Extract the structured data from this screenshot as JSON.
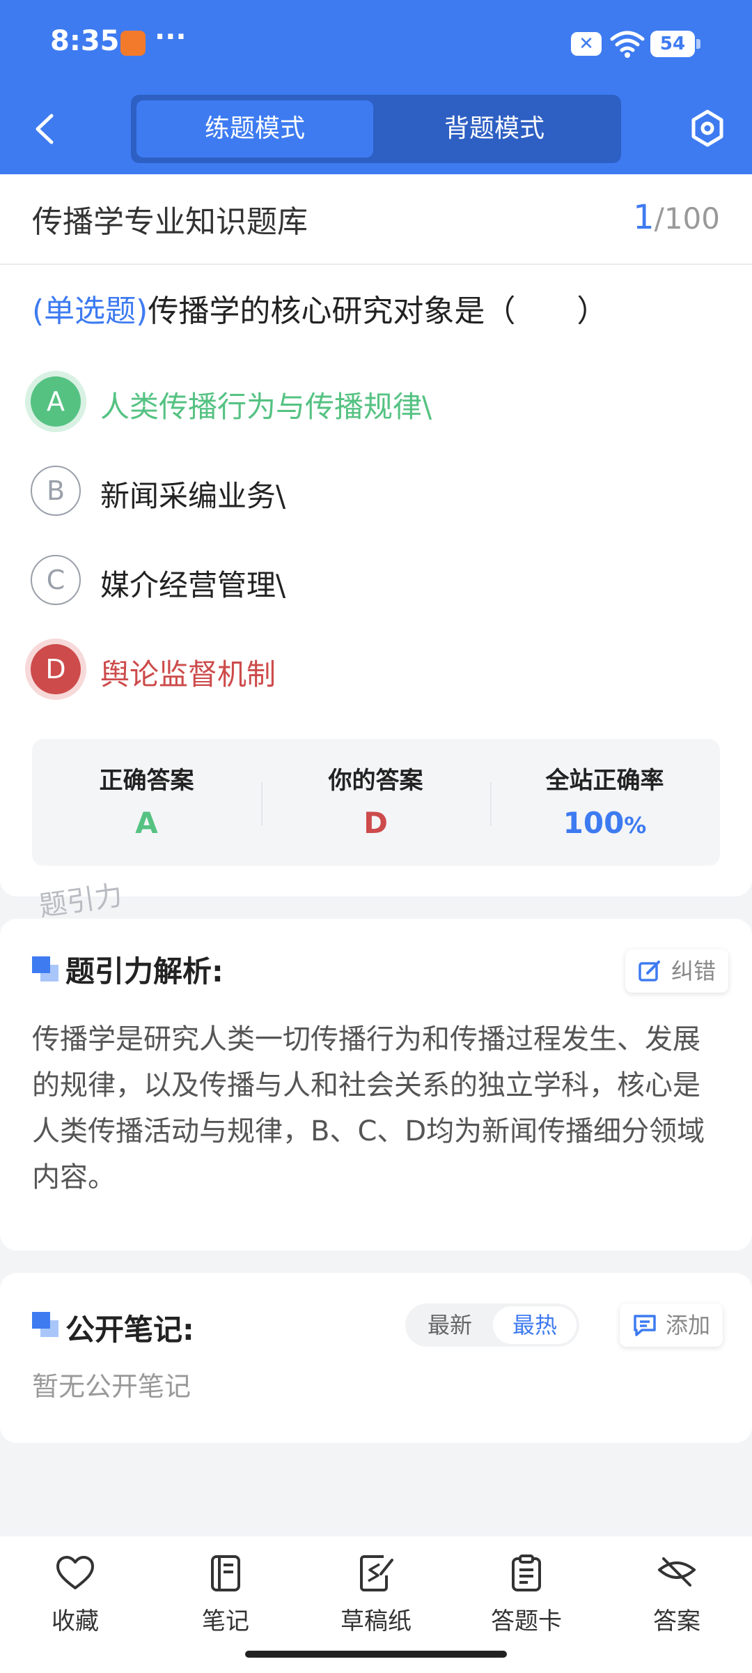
{
  "status_bar": {
    "time": "8:35",
    "more": "···",
    "battery": "54"
  },
  "header": {
    "tabs": [
      {
        "label": "练题模式",
        "active": true
      },
      {
        "label": "背题模式",
        "active": false
      }
    ],
    "accent_color": "#3e7bf1"
  },
  "question": {
    "bank_title": "传播学专业知识题库",
    "progress_current": "1",
    "progress_total": "/100",
    "type_label": "(单选题)",
    "text": "传播学的核心研究对象是（　　）",
    "options": [
      {
        "letter": "A",
        "text": "人类传播行为与传播规律\\",
        "state": "correct"
      },
      {
        "letter": "B",
        "text": "新闻采编业务\\",
        "state": "normal"
      },
      {
        "letter": "C",
        "text": "媒介经营管理\\",
        "state": "normal"
      },
      {
        "letter": "D",
        "text": "舆论监督机制",
        "state": "wrong"
      }
    ]
  },
  "answer_summary": {
    "correct_label": "正确答案",
    "correct_value": "A",
    "correct_color": "#55c282",
    "yours_label": "你的答案",
    "yours_value": "D",
    "yours_color": "#cd4b4b",
    "rate_label": "全站正确率",
    "rate_value": "100",
    "rate_unit": "%",
    "rate_color": "#3e7bf1"
  },
  "watermark": "题引力",
  "analysis": {
    "title": "题引力解析:",
    "report_label": "纠错",
    "text": "传播学是研究人类一切传播行为和传播过程发生、发展的规律，以及传播与人和社会关系的独立学科，核心是人类传播活动与规律，B、C、D均为新闻传播细分领域内容。"
  },
  "notes": {
    "title": "公开笔记:",
    "sort_latest": "最新",
    "sort_hot": "最热",
    "add_label": "添加",
    "empty_text": "暂无公开笔记"
  },
  "bottom_nav": {
    "items": [
      {
        "label": "收藏",
        "icon": "heart-icon"
      },
      {
        "label": "笔记",
        "icon": "notebook-icon"
      },
      {
        "label": "草稿纸",
        "icon": "draft-icon"
      },
      {
        "label": "答题卡",
        "icon": "clipboard-icon"
      },
      {
        "label": "答案",
        "icon": "eye-off-icon"
      }
    ]
  }
}
